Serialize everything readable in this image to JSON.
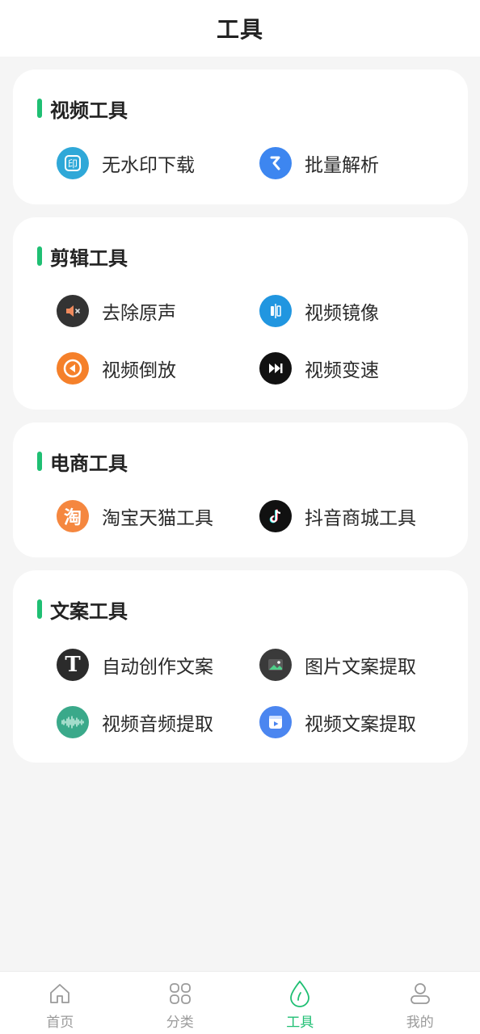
{
  "header": {
    "title": "工具"
  },
  "sections": [
    {
      "title": "视频工具",
      "tools": [
        {
          "label": "无水印下载",
          "icon": "watermark-stamp-icon",
          "color": "#2fa8d8"
        },
        {
          "label": "批量解析",
          "icon": "batch-parse-icon",
          "color": "#3d86f0"
        }
      ]
    },
    {
      "title": "剪辑工具",
      "tools": [
        {
          "label": "去除原声",
          "icon": "mute-speaker-icon",
          "color": "#333333"
        },
        {
          "label": "视频镜像",
          "icon": "mirror-icon",
          "color": "#2196e0"
        },
        {
          "label": "视频倒放",
          "icon": "rewind-icon",
          "color": "#f5802a"
        },
        {
          "label": "视频变速",
          "icon": "fast-forward-icon",
          "color": "#111111"
        }
      ]
    },
    {
      "title": "电商工具",
      "tools": [
        {
          "label": "淘宝天猫工具",
          "icon": "taobao-icon",
          "icon_text": "淘",
          "color": "#f5873f"
        },
        {
          "label": "抖音商城工具",
          "icon": "tiktok-icon",
          "color": "#111111"
        }
      ]
    },
    {
      "title": "文案工具",
      "tools": [
        {
          "label": "自动创作文案",
          "icon": "text-t-icon",
          "icon_text": "T",
          "color": "#2b2b2b"
        },
        {
          "label": "图片文案提取",
          "icon": "image-icon",
          "color": "#3a3a3a"
        },
        {
          "label": "视频音频提取",
          "icon": "audio-wave-icon",
          "color": "#3aa98a"
        },
        {
          "label": "视频文案提取",
          "icon": "video-box-icon",
          "color": "#4b86f0"
        }
      ]
    }
  ],
  "tabbar": {
    "items": [
      {
        "label": "首页",
        "icon": "home-icon"
      },
      {
        "label": "分类",
        "icon": "grid-icon"
      },
      {
        "label": "工具",
        "icon": "drop-icon"
      },
      {
        "label": "我的",
        "icon": "user-icon"
      }
    ],
    "active_index": 2,
    "active_color": "#1fbf73",
    "inactive_color": "#9a9a9a"
  },
  "accent_color": "#1fbf73"
}
